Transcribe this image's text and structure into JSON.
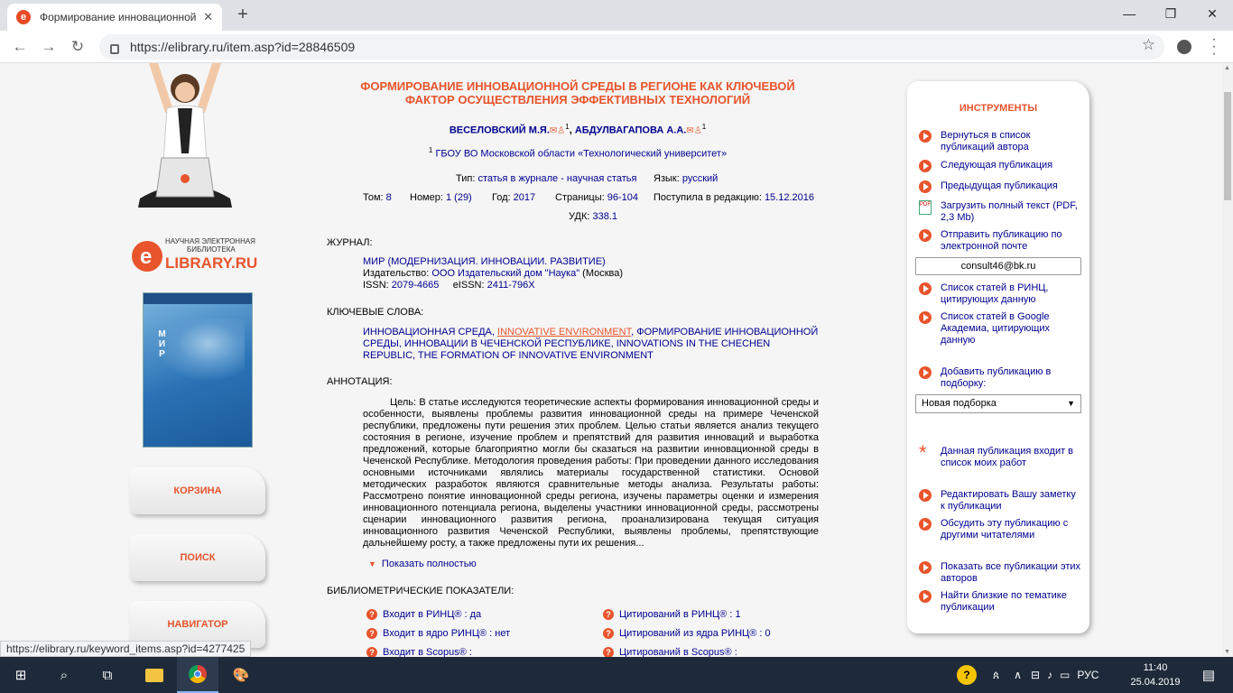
{
  "browser": {
    "tab_title": "Формирование инновационной",
    "url": "https://elibrary.ru/item.asp?id=28846509"
  },
  "left": {
    "logo_line1": "НАУЧНАЯ ЭЛЕКТРОННАЯ",
    "logo_line2": "БИБЛИОТЕКА",
    "logo_main": "LIBRARY.RU",
    "cover_title": "МИР",
    "buttons": [
      "КОРЗИНА",
      "ПОИСК",
      "НАВИГАТОР"
    ]
  },
  "article": {
    "title": "ФОРМИРОВАНИЕ ИННОВАЦИОННОЙ СРЕДЫ В РЕГИОНЕ КАК КЛЮЧЕВОЙ ФАКТОР ОСУЩЕСТВЛЕНИЯ ЭФФЕКТИВНЫХ ТЕХНОЛОГИЙ",
    "author1": "ВЕСЕЛОВСКИЙ М.Я.",
    "author2": "АБДУЛВАГАПОВА А.А.",
    "sup": "1",
    "sep": ", ",
    "affiliation": "ГБОУ ВО Московской области «Технологический университет»",
    "type_label": "Тип:",
    "type": "статья в журнале - научная статья",
    "lang_label": "Язык:",
    "lang": "русский",
    "vol_label": "Том:",
    "vol": "8",
    "num_label": "Номер:",
    "num": "1 (29)",
    "year_label": "Год:",
    "year": "2017",
    "pages_label": "Страницы:",
    "pages": "96-104",
    "recv_label": "Поступила в редакцию:",
    "recv": "15.12.2016",
    "udk_label": "УДК:",
    "udk": "338.1",
    "journal_head": "ЖУРНАЛ:",
    "journal": "МИР (МОДЕРНИЗАЦИЯ. ИННОВАЦИИ. РАЗВИТИЕ)",
    "publisher_label": "Издательство:",
    "publisher": "ООО Издательский дом \"Наука\"",
    "publisher_city": "(Москва)",
    "issn_label": "ISSN:",
    "issn": "2079-4665",
    "eissn_label": "eISSN:",
    "eissn": "2411-796X",
    "kw_head": "КЛЮЧЕВЫЕ СЛОВА:",
    "kw1": "ИННОВАЦИОННАЯ СРЕДА",
    "kw2": "INNOVATIVE ENVIRONMENT",
    "kw3": "ФОРМИРОВАНИЕ ИННОВАЦИОННОЙ СРЕДЫ, ИННОВАЦИИ В ЧЕЧЕНСКОЙ РЕСПУБЛИКЕ, INNOVATIONS IN THE CHECHEN REPUBLIC, THE FORMATION OF INNOVATIVE ENVIRONMENT",
    "annot_head": "АННОТАЦИЯ:",
    "annotation": "Цель: В статье исследуются теоретические аспекты формирования инновационной среды и особенности, выявлены проблемы развития инновационной среды на примере Чеченской республики, предложены пути решения этих проблем. Целью статьи является анализ текущего состояния в регионе, изучение проблем и препятствий для развития инноваций и выработка предложений, которые благоприятно могли бы сказаться на развитии инновационной среды в Чеченской Республике. Методология проведения работы: При проведении данного исследования основными источниками являлись материалы государственной статистики. Основой методических разработок являются сравнительные методы анализа. Результаты работы: Рассмотрено понятие инновационной среды региона, изучены параметры оценки и измерения инновационного потенциала региона, выделены участники инновационной среды, рассмотрены сценарии инновационного развития региона, проанализирована текущая ситуация инновационного развития Чеченской Республики, выявлены проблемы, препятствующие дальнейшему росту, а также предложены пути их решения...",
    "show_full": "Показать полностью",
    "biblio_head": "БИБЛИОМЕТРИЧЕСКИЕ ПОКАЗАТЕЛИ:",
    "m1": "Входит в РИНЦ® : да",
    "m2": "Цитирований в РИНЦ® : 1",
    "m3": "Входит в ядро РИНЦ® : нет",
    "m4": "Цитирований из ядра РИНЦ® : 0",
    "m5": "Входит в Scopus® :",
    "m6": "Цитирований в Scopus® :"
  },
  "panel": {
    "title": "ИНСТРУМЕНТЫ",
    "items": [
      "Вернуться в список публикаций автора",
      "Следующая публикация",
      "Предыдущая публикация",
      "Загрузить полный текст (PDF, 2,3 Mb)",
      "Отправить публикацию по электронной почте",
      "Список статей в РИНЦ, цитирующих данную",
      "Список статей в Google Академиа, цитирующих данную",
      "Добавить публикацию в подборку:",
      "Данная публикация входит в список моих работ",
      "Редактировать Вашу заметку к публикации",
      "Обсудить эту публикацию с другими читателями",
      "Показать все публикации этих авторов",
      "Найти близкие по тематике публикации"
    ],
    "email": "consult46@bk.ru",
    "select": "Новая подборка"
  },
  "status_url": "https://elibrary.ru/keyword_items.asp?id=4277425",
  "taskbar": {
    "lang": "РУС",
    "time": "11:40",
    "date": "25.04.2019"
  }
}
